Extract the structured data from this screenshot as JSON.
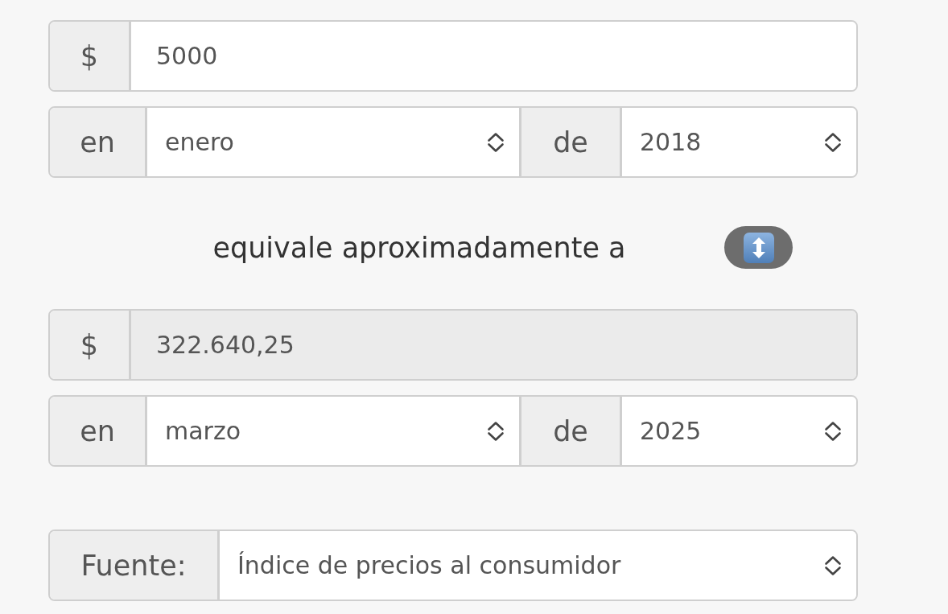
{
  "amount": {
    "currency": "$",
    "value": "5000",
    "readonly": false
  },
  "from_date": {
    "month_label": "en",
    "month": "enero",
    "year_label": "de",
    "year": "2018"
  },
  "equivalence_text": "equivale aproximadamente a",
  "result": {
    "currency": "$",
    "value": "322.640,25",
    "readonly": true
  },
  "to_date": {
    "month_label": "en",
    "month": "marzo",
    "year_label": "de",
    "year": "2025"
  },
  "source": {
    "label": "Fuente:",
    "value": "Índice de precios al consumidor"
  }
}
